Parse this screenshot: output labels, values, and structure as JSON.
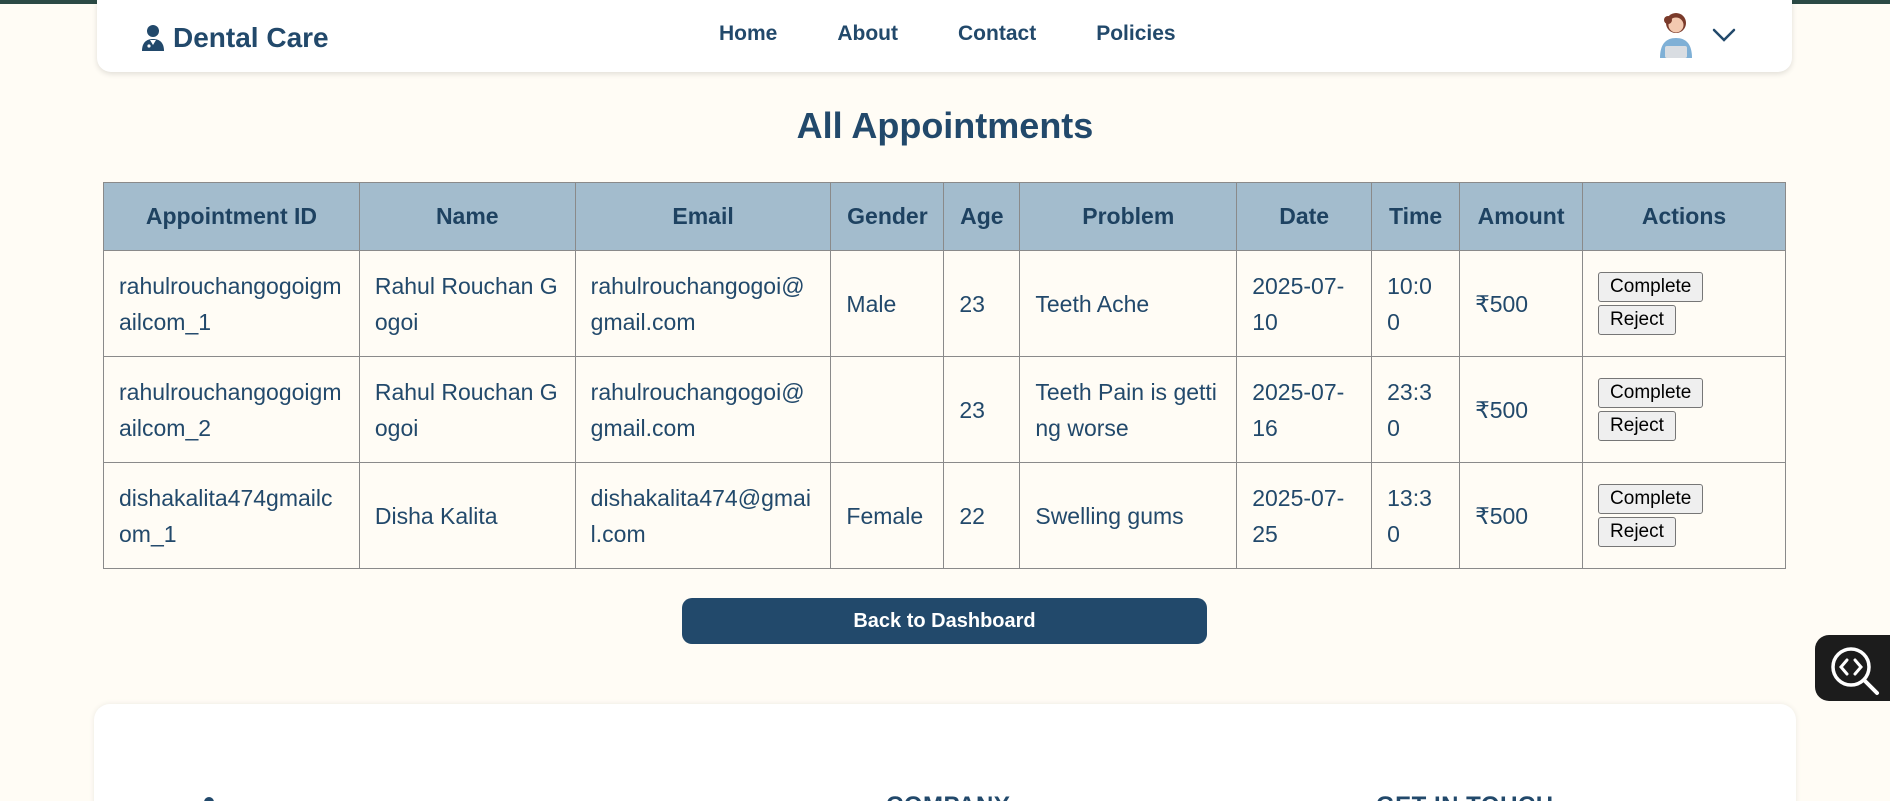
{
  "brand": {
    "name": "Dental Care"
  },
  "nav": {
    "items": [
      "Home",
      "About",
      "Contact",
      "Policies"
    ]
  },
  "page": {
    "title": "All Appointments"
  },
  "table": {
    "columns": [
      "Appointment ID",
      "Name",
      "Email",
      "Gender",
      "Age",
      "Problem",
      "Date",
      "Time",
      "Amount",
      "Actions"
    ],
    "rows": [
      {
        "id": "rahulrouchangogoigmailcom_1",
        "name": "Rahul Rouchan Gogoi",
        "email": "rahulrouchangogoi@gmail.com",
        "gender": "Male",
        "age": "23",
        "problem": "Teeth Ache",
        "date": "2025-07-10",
        "time": "10:00",
        "amount": "₹500"
      },
      {
        "id": "rahulrouchangogoigmailcom_2",
        "name": "Rahul Rouchan Gogoi",
        "email": "rahulrouchangogoi@gmail.com",
        "gender": "",
        "age": "23",
        "problem": "Teeth Pain is getting worse",
        "date": "2025-07-16",
        "time": "23:30",
        "amount": "₹500"
      },
      {
        "id": "dishakalita474gmailcom_1",
        "name": "Disha Kalita",
        "email": "dishakalita474@gmail.com",
        "gender": "Female",
        "age": "22",
        "problem": "Swelling gums",
        "date": "2025-07-25",
        "time": "13:30",
        "amount": "₹500"
      }
    ],
    "actions": {
      "complete": "Complete",
      "reject": "Reject"
    }
  },
  "back_button": {
    "label": "Back to Dashboard"
  },
  "footer": {
    "headings": [
      "COMPANY",
      "GET IN TOUCH"
    ]
  },
  "icons": {
    "brand": "doctor-person-icon",
    "avatar": "user-avatar",
    "chevron": "chevron-down-icon",
    "fab": "code-search-icon"
  },
  "colors": {
    "primary": "#22496b",
    "table_header": "#a3bccd",
    "background": "#fffcf5",
    "topbar": "#2b4a45"
  }
}
